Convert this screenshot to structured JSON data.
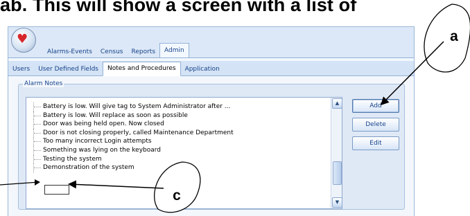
{
  "document": {
    "heading": "ab. This will show a screen with a list of"
  },
  "app": {
    "logo_icon": "red-heart-orb"
  },
  "main_tabs": [
    {
      "label": "Alarms-Events",
      "active": false
    },
    {
      "label": "Census",
      "active": false
    },
    {
      "label": "Reports",
      "active": false
    },
    {
      "label": "Admin",
      "active": true
    }
  ],
  "sub_tabs": [
    {
      "label": "Users",
      "active": false
    },
    {
      "label": "User Defined Fields",
      "active": false
    },
    {
      "label": "Notes and Procedures",
      "active": true
    },
    {
      "label": "Application",
      "active": false
    }
  ],
  "alarm_notes": {
    "title": "Alarm Notes",
    "items": [
      "Battery is low. Will give tag to System Administrator after ...",
      "Battery is low. Will replace as soon as possible",
      "Door was being held open. Now closed",
      "Door is not closing properly, called Maintenance Department",
      "Too many incorrect Login attempts",
      "Something was lying on the keyboard",
      "Testing the system",
      "Demonstration of the system"
    ],
    "new_item_value": ""
  },
  "buttons": {
    "add": "Add",
    "delete": "Delete",
    "edit": "Edit"
  },
  "annotations": {
    "a_label": "a",
    "c_label": "c"
  }
}
